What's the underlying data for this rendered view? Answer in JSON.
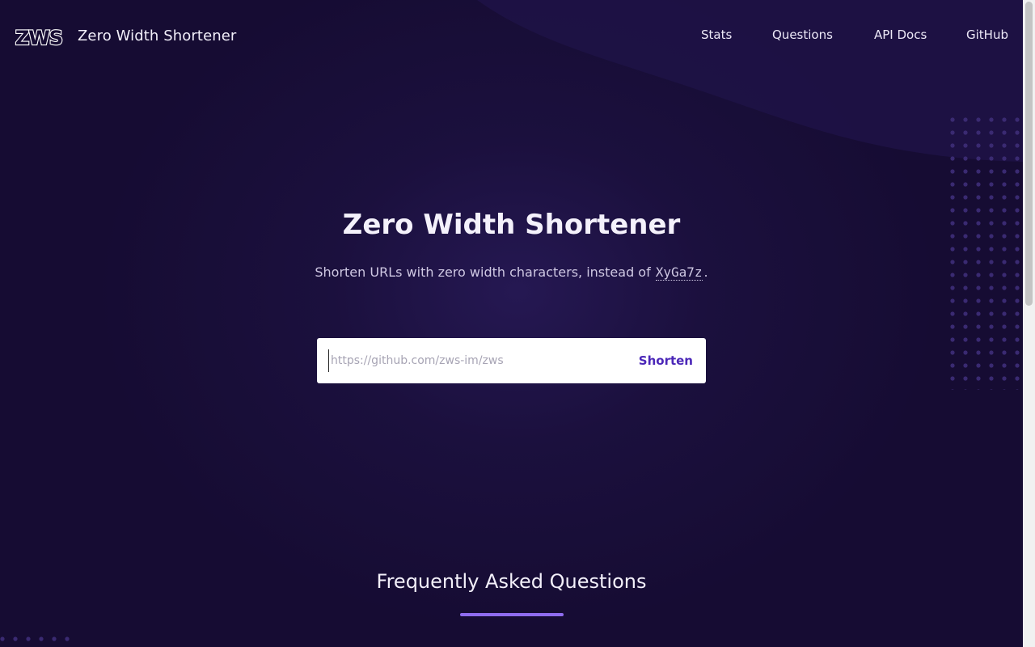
{
  "header": {
    "logo_text": "ZWS",
    "site_title": "Zero Width Shortener",
    "nav": [
      {
        "label": "Stats"
      },
      {
        "label": "Questions"
      },
      {
        "label": "API Docs"
      },
      {
        "label": "GitHub"
      }
    ]
  },
  "hero": {
    "title": "Zero Width Shortener",
    "subtitle_prefix": "Shorten URLs with zero width characters, instead of",
    "subtitle_code": "XyGa7z",
    "subtitle_suffix": "."
  },
  "form": {
    "input_value": "",
    "input_placeholder": "https://github.com/zws-im/zws",
    "button_label": "Shorten"
  },
  "faq": {
    "title": "Frequently Asked Questions"
  },
  "colors": {
    "background": "#160c33",
    "accent": "#8f6cf0",
    "button_text": "#4b27b8",
    "dots": "#3a2a72"
  }
}
